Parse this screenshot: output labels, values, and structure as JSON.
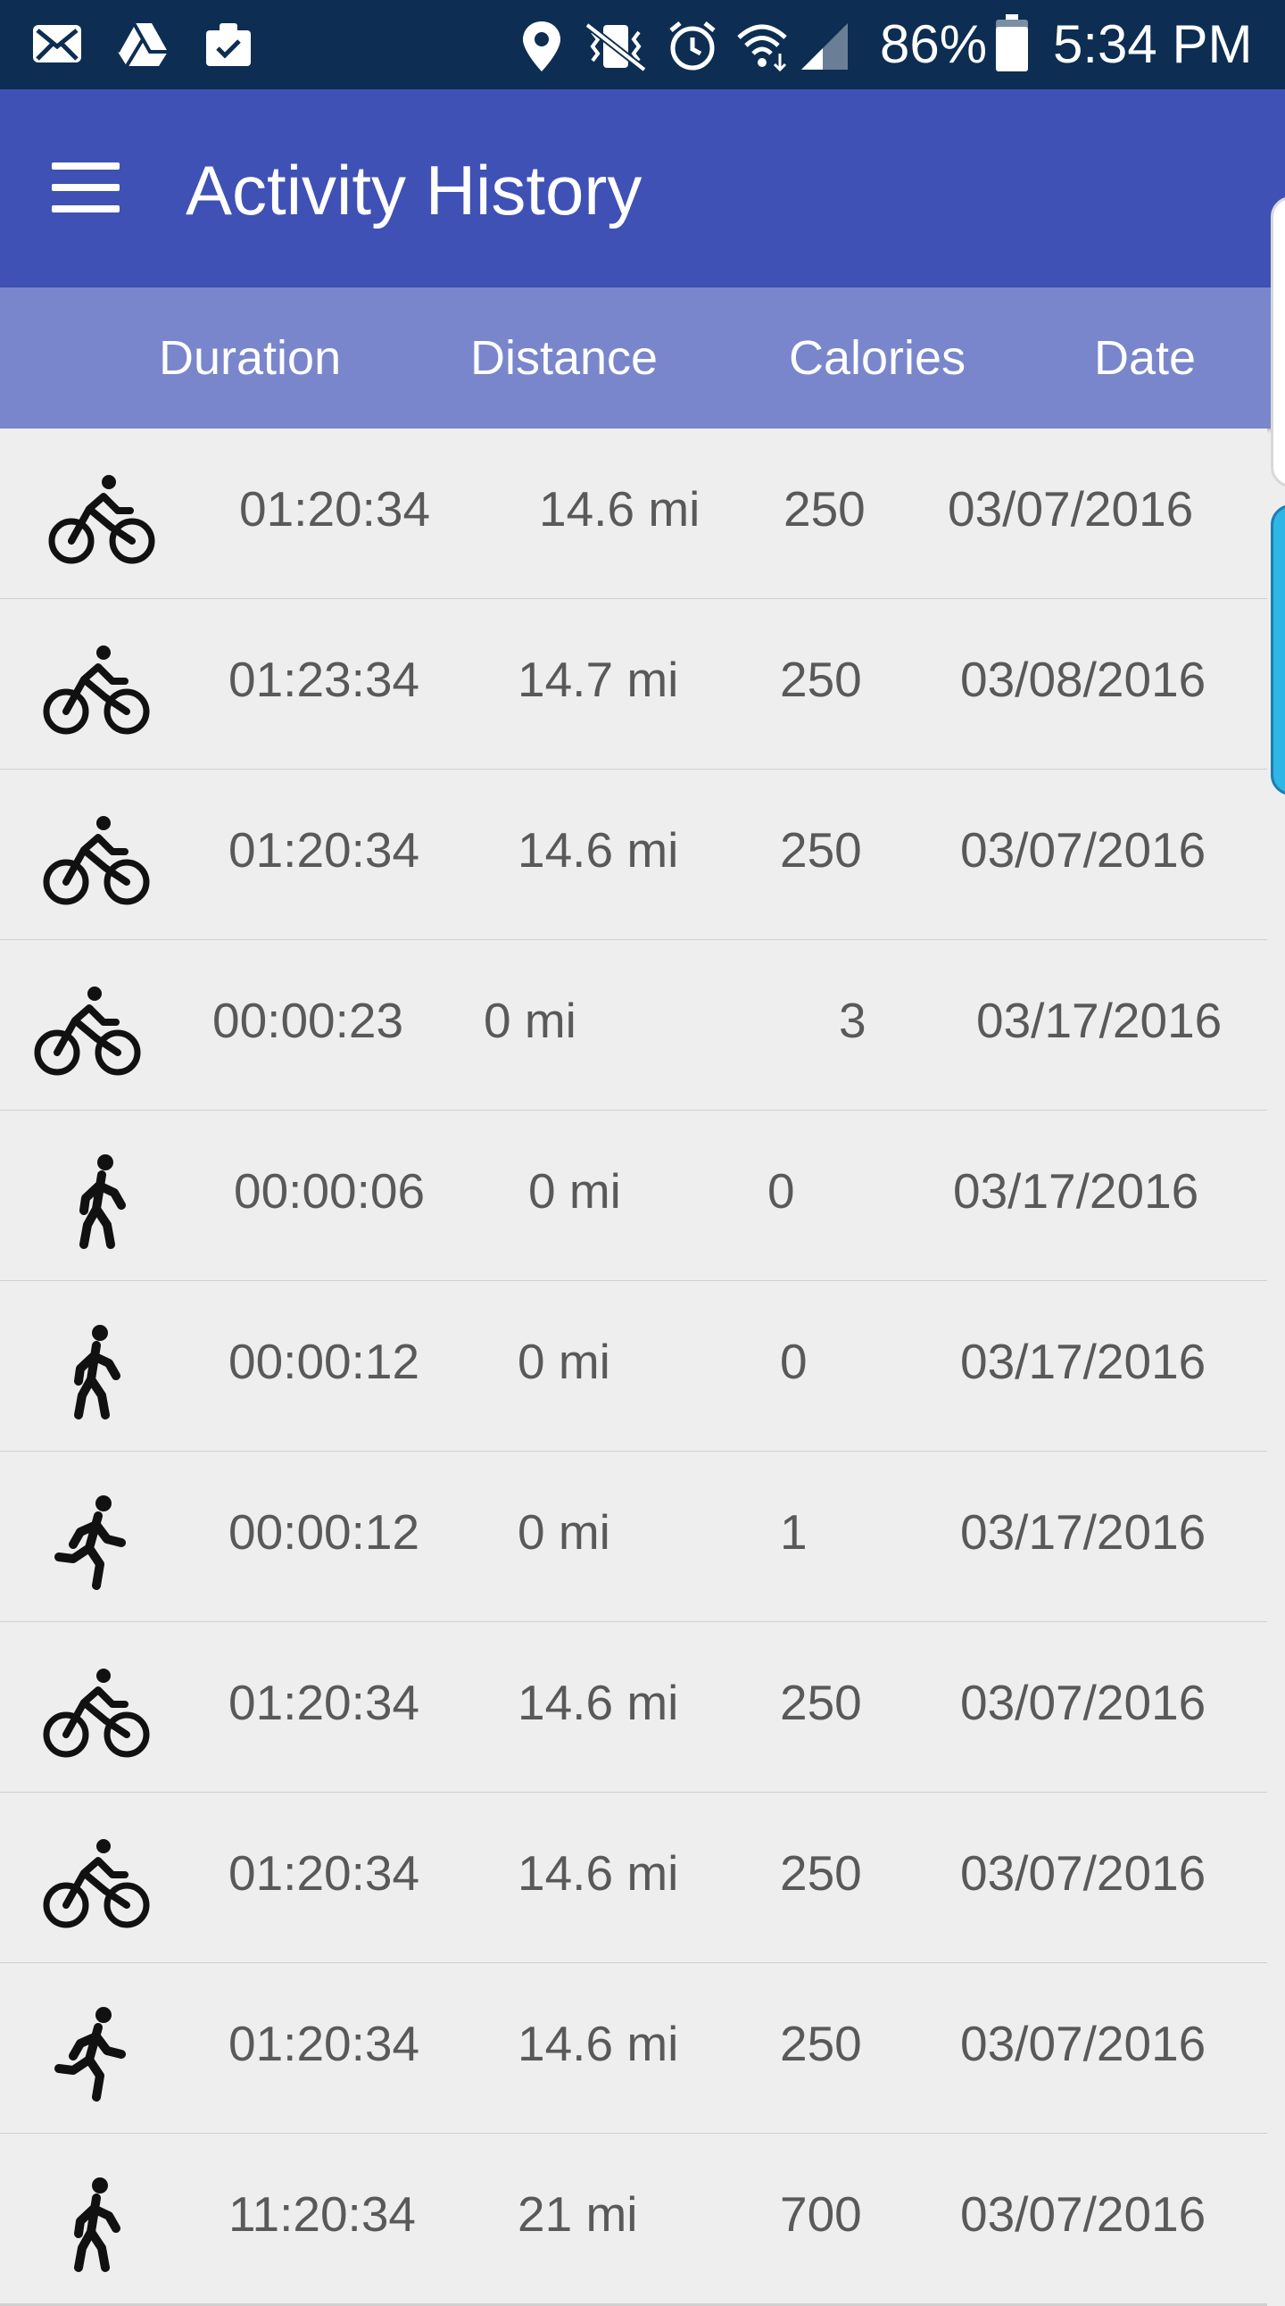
{
  "status_bar": {
    "icons": [
      "mail-icon",
      "drive-icon",
      "clipboard-icon",
      "location-icon",
      "vibrate-icon",
      "alarm-icon",
      "wifi-icon",
      "signal-icon",
      "battery-icon"
    ],
    "battery": "86%",
    "time": "5:34 PM"
  },
  "app_bar": {
    "title": "Activity History",
    "menu_icon": "hamburger-menu-icon"
  },
  "columns": [
    "Duration",
    "Distance",
    "Calories",
    "Date"
  ],
  "activities": [
    {
      "type": "bike",
      "duration": "01:20:34",
      "distance": "14.6 mi",
      "calories": "250",
      "date": "03/07/2016"
    },
    {
      "type": "bike",
      "duration": "01:23:34",
      "distance": "14.7 mi",
      "calories": "250",
      "date": "03/08/2016"
    },
    {
      "type": "bike",
      "duration": "01:20:34",
      "distance": "14.6 mi",
      "calories": "250",
      "date": "03/07/2016"
    },
    {
      "type": "bike",
      "duration": "00:00:23",
      "distance": "0 mi",
      "calories": "3",
      "date": "03/17/2016"
    },
    {
      "type": "walk",
      "duration": "00:00:06",
      "distance": "0 mi",
      "calories": "0",
      "date": "03/17/2016"
    },
    {
      "type": "walk",
      "duration": "00:00:12",
      "distance": "0 mi",
      "calories": "0",
      "date": "03/17/2016"
    },
    {
      "type": "run",
      "duration": "00:00:12",
      "distance": "0 mi",
      "calories": "1",
      "date": "03/17/2016"
    },
    {
      "type": "bike",
      "duration": "01:20:34",
      "distance": "14.6 mi",
      "calories": "250",
      "date": "03/07/2016"
    },
    {
      "type": "bike",
      "duration": "01:20:34",
      "distance": "14.6 mi",
      "calories": "250",
      "date": "03/07/2016"
    },
    {
      "type": "run",
      "duration": "01:20:34",
      "distance": "14.6 mi",
      "calories": "250",
      "date": "03/07/2016"
    },
    {
      "type": "walk",
      "duration": "11:20:34",
      "distance": "21 mi",
      "calories": "700",
      "date": "03/07/2016"
    }
  ],
  "colors": {
    "status_bar": "#0d2e52",
    "app_bar": "#3f51b5",
    "header_row": "#7986cb",
    "row_background": "#eeeeee",
    "row_text": "#595959"
  }
}
